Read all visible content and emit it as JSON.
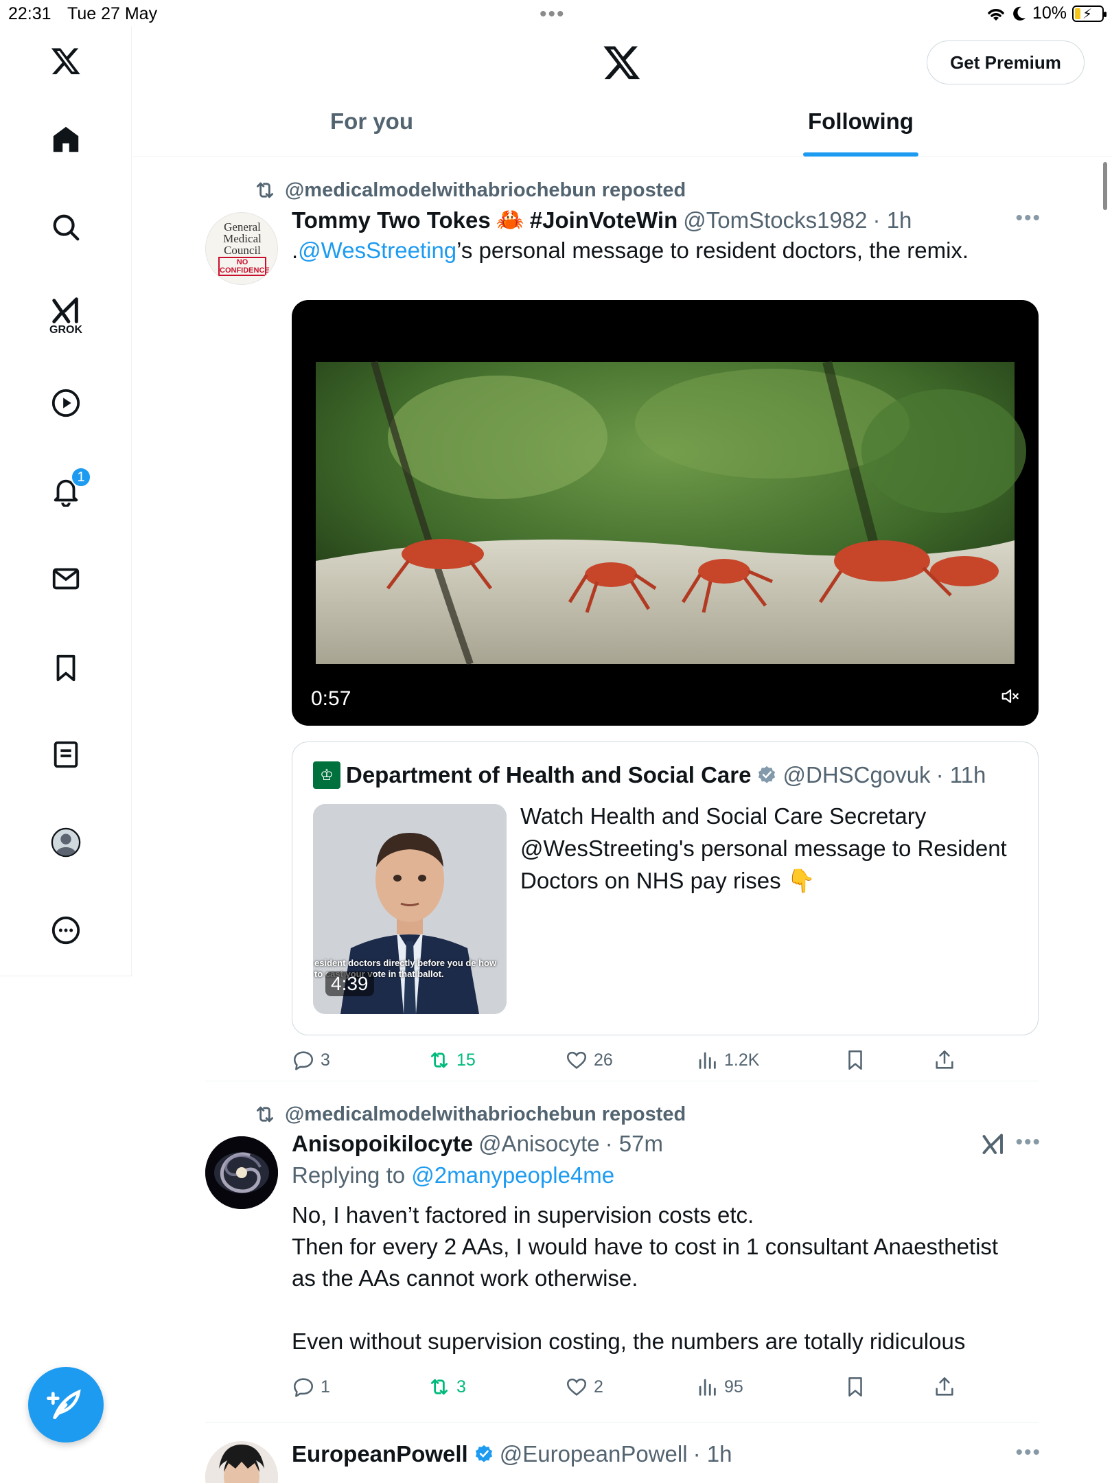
{
  "status_bar": {
    "time": "22:31",
    "date": "Tue 27 May",
    "battery": "10%"
  },
  "sidebar": {
    "items": [
      {
        "icon": "x-logo-icon"
      },
      {
        "icon": "home-icon"
      },
      {
        "icon": "search-icon"
      },
      {
        "icon": "grok-icon",
        "label": "GROK"
      },
      {
        "icon": "video-play-icon"
      },
      {
        "icon": "bell-icon",
        "badge": "1"
      },
      {
        "icon": "mail-icon"
      },
      {
        "icon": "bookmark-icon"
      },
      {
        "icon": "list-icon"
      },
      {
        "icon": "profile-icon"
      },
      {
        "icon": "more-icon"
      }
    ],
    "compose_icon": "compose-feather-icon"
  },
  "header": {
    "premium_label": "Get Premium",
    "tabs": [
      {
        "label": "For you",
        "active": false
      },
      {
        "label": "Following",
        "active": true
      }
    ],
    "accent": "#1d9bf0"
  },
  "tweets": [
    {
      "repost_by": "@medicalmodelwithabriochebun reposted",
      "author_name": "Tommy Two Tokes",
      "author_suffix": "#JoinVoteWin",
      "emoji": "🦀",
      "handle": "@TomStocks1982",
      "time": "· 1h",
      "text_prefix": ".",
      "text_link": "@WesStreeting",
      "text_rest": "’s personal message to resident doctors, the remix.",
      "avatar_lines": [
        "General",
        "Medical",
        "Council",
        "NO",
        "CONFIDENCE"
      ],
      "video": {
        "duration": "0:57"
      },
      "quote": {
        "author_name": "Department of Health and Social Care",
        "handle": "@DHSCgovuk",
        "time": "· 11h",
        "text": "Watch Health and Social Care Secretary @WesStreeting's personal message to Resident Doctors on NHS pay rises",
        "emoji": "👇",
        "thumb_caption": "esident doctors directly before you de how to cast your vote in that ballot.",
        "thumb_duration": "4:39"
      },
      "actions": {
        "replies": "3",
        "reposts": "15",
        "likes": "26",
        "views": "1.2K"
      }
    },
    {
      "repost_by": "@medicalmodelwithabriochebun reposted",
      "author_name": "Anisopoikilocyte",
      "handle": "@Anisocyte",
      "time": "· 57m",
      "replying_prefix": "Replying to",
      "replying_to": "@2manypeople4me",
      "text_lines": [
        "No, I haven’t factored in supervision costs etc.",
        "Then for every 2 AAs, I would have to cost in 1 consultant Anaesthetist",
        "as the AAs cannot work otherwise.",
        "",
        "Even without supervision costing, the numbers are totally ridiculous"
      ],
      "actions": {
        "replies": "1",
        "reposts": "3",
        "likes": "2",
        "views": "95"
      }
    },
    {
      "author_name": "EuropeanPowell",
      "handle": "@EuropeanPowell",
      "time": "· 1h"
    }
  ]
}
